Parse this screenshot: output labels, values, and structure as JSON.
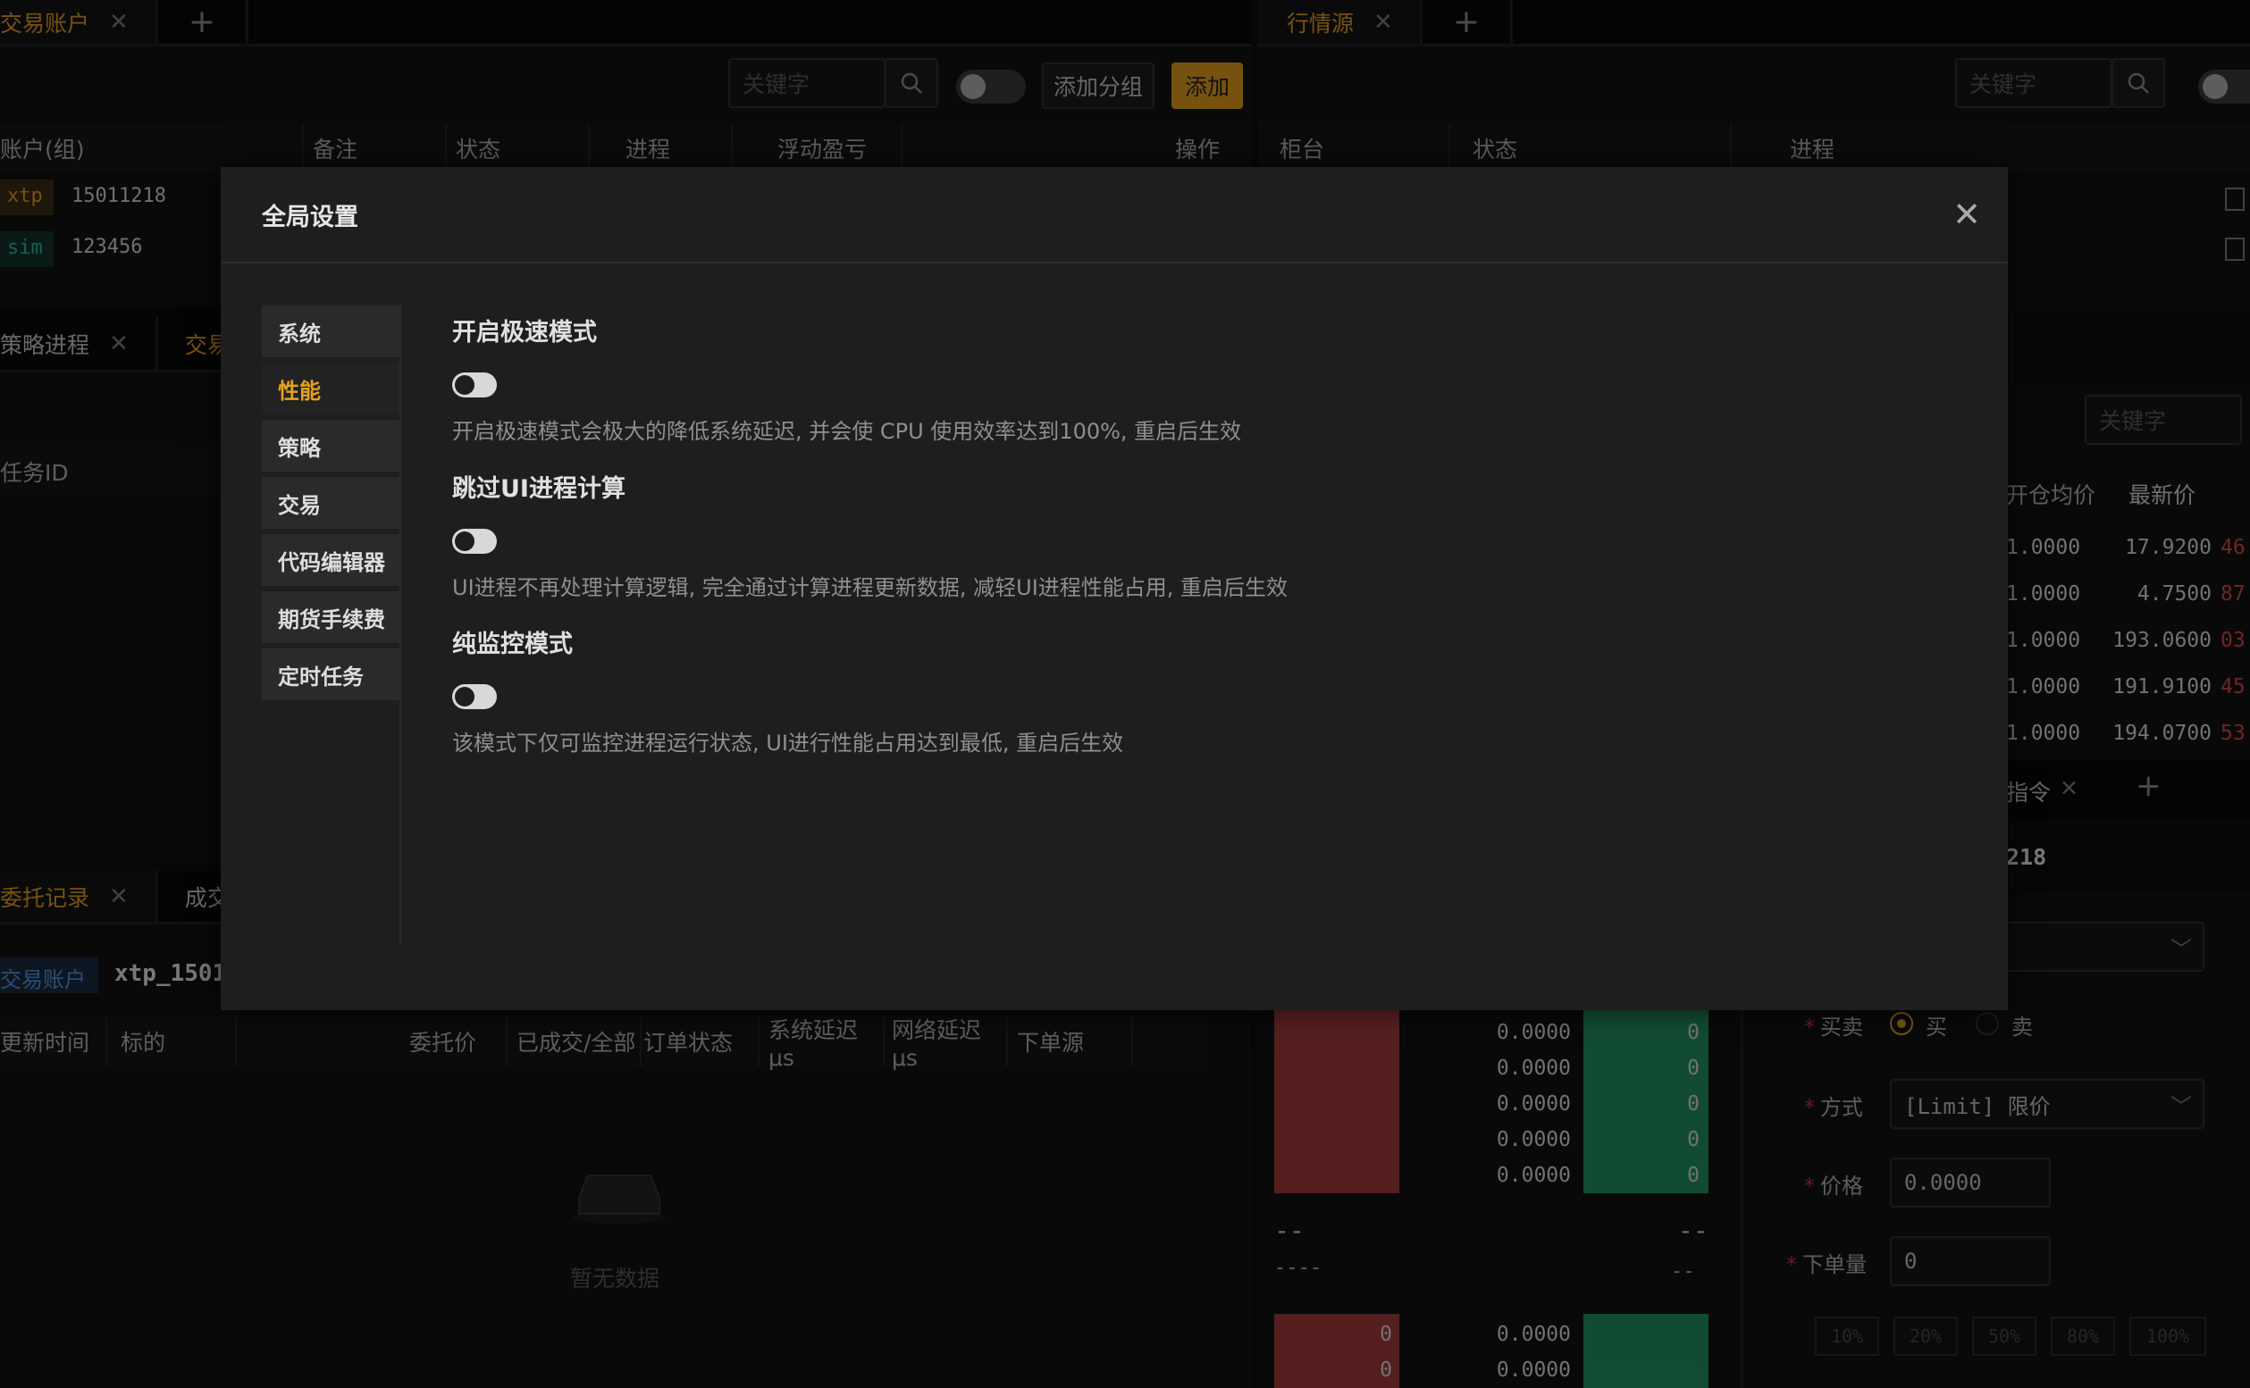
{
  "left_panel": {
    "tabs": [
      {
        "label": "交易账户"
      }
    ],
    "search_placeholder": "关键字",
    "add_group_label": "添加分组",
    "add_label": "添加",
    "columns": [
      "账户(组)",
      "备注",
      "状态",
      "进程",
      "浮动盈亏",
      "操作"
    ],
    "accounts": [
      {
        "tag": "xtp",
        "id": "15011218"
      },
      {
        "tag": "sim",
        "id": "123456"
      }
    ],
    "mid_tabs": [
      "策略进程",
      "交易"
    ],
    "task_col": "任务ID",
    "bottom_tabs": [
      "委托记录",
      "成交"
    ],
    "account_badge": "交易账户",
    "account_value": "xtp_1501",
    "order_columns": [
      "更新时间",
      "标的",
      "委托价",
      "已成交/全部",
      "订单状态",
      "系统延迟μs",
      "网络延迟μs",
      "下单源"
    ],
    "empty_text": "暂无数据"
  },
  "right_panel": {
    "tabs": [
      {
        "label": "行情源"
      }
    ],
    "search_placeholder": "关键字",
    "columns": [
      "柜台",
      "状态",
      "进程"
    ],
    "search2_placeholder": "关键字",
    "pos_columns": [
      "开仓均价",
      "最新价"
    ],
    "positions": [
      {
        "avg": "1.0000",
        "last": "17.9200",
        "extra": "46"
      },
      {
        "avg": "1.0000",
        "last": "4.7500",
        "extra": "87"
      },
      {
        "avg": "1.0000",
        "last": "193.0600",
        "extra": "03"
      },
      {
        "avg": "1.0000",
        "last": "191.9100",
        "extra": "45"
      },
      {
        "avg": "1.0000",
        "last": "194.0700",
        "extra": "53"
      }
    ],
    "order_tab": "指令",
    "account_short": "218",
    "depth_prices": [
      "0.0000",
      "0.0000",
      "0.0000",
      "0.0000",
      "0.0000"
    ],
    "depth_vols": [
      "0",
      "0",
      "0",
      "0",
      "0"
    ],
    "mid_left": "--",
    "mid_right": "--",
    "mid2_left": "----",
    "mid2_right": "--",
    "depth2_prices": [
      "0.0000",
      "0.0000"
    ],
    "depth2_vols": [
      "0",
      "0"
    ],
    "form": {
      "side_label": "买卖",
      "buy": "买",
      "sell": "卖",
      "method_label": "方式",
      "method_value": "[Limit] 限价",
      "price_label": "价格",
      "price_value": "0.0000",
      "qty_label": "下单量",
      "qty_value": "0",
      "pcts": [
        "10%",
        "20%",
        "50%",
        "80%",
        "100%"
      ]
    }
  },
  "modal": {
    "title": "全局设置",
    "menu": [
      "系统",
      "性能",
      "策略",
      "交易",
      "代码编辑器",
      "期货手续费",
      "定时任务"
    ],
    "active_menu": "性能",
    "options": [
      {
        "title": "开启极速模式",
        "desc": "开启极速模式会极大的降低系统延迟, 并会使 CPU 使用效率达到100%, 重启后生效",
        "on": false
      },
      {
        "title": "跳过UI进程计算",
        "desc": "UI进程不再处理计算逻辑, 完全通过计算进程更新数据, 减轻UI进程性能占用, 重启后生效",
        "on": false
      },
      {
        "title": "纯监控模式",
        "desc": "该模式下仅可监控进程运行状态, UI进行性能占用达到最低, 重启后生效",
        "on": false
      }
    ]
  }
}
